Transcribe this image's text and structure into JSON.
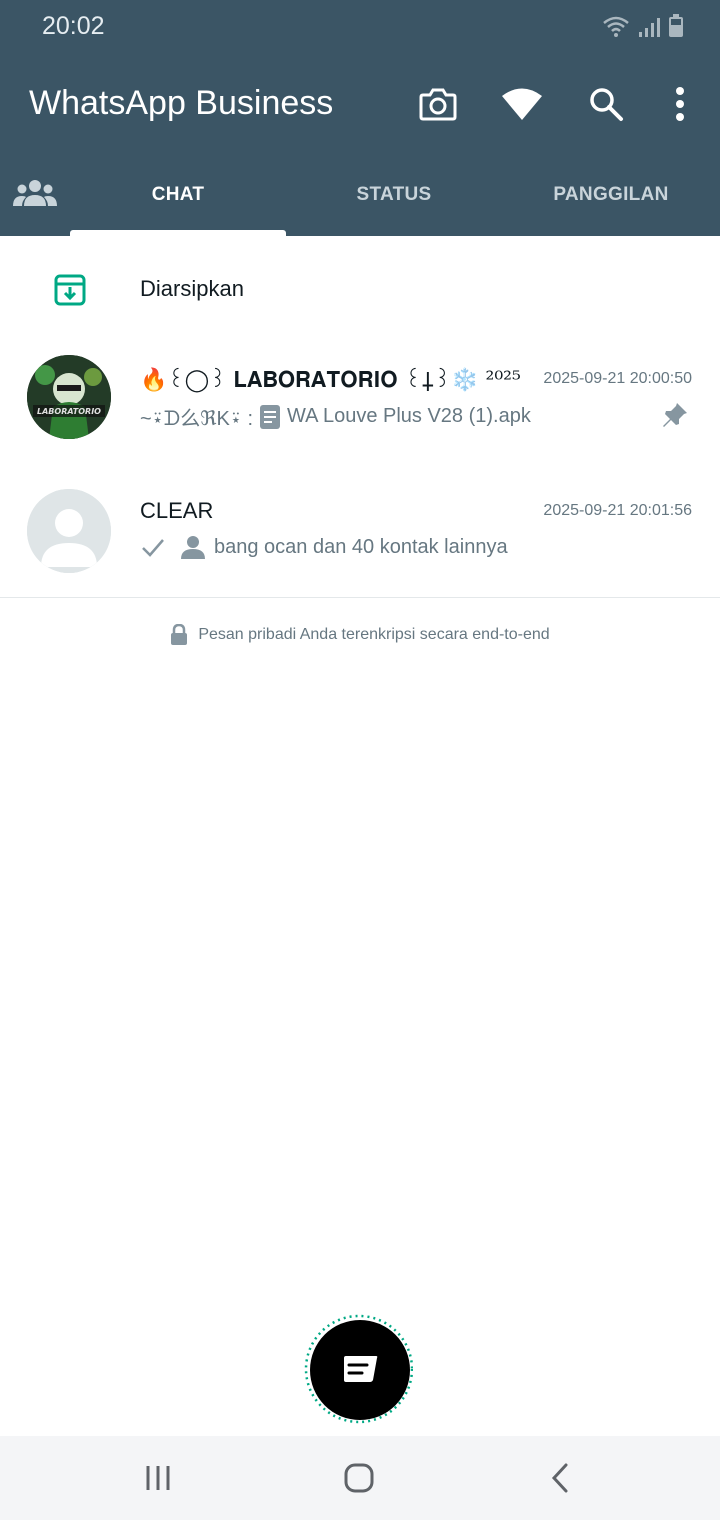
{
  "status_bar": {
    "time": "20:02",
    "icons": [
      "wifi-icon",
      "signal-icon",
      "battery-icon"
    ]
  },
  "app_bar": {
    "title": "WhatsApp Business",
    "actions": [
      "camera-icon",
      "wifi-status-icon",
      "search-icon",
      "more-options-icon"
    ]
  },
  "tabs": {
    "community_icon": "community-icon",
    "items": [
      {
        "label": "CHAT",
        "selected": true
      },
      {
        "label": "STATUS",
        "selected": false
      },
      {
        "label": "PANGGILAN",
        "selected": false
      }
    ]
  },
  "archived": {
    "label": "Diarsipkan",
    "icon": "archive-icon"
  },
  "chats": [
    {
      "name": "🔥꒰◯꒱ 𝐋𝐀𝐁𝐎𝐑𝐀𝐓𝐎𝐑𝐈𝐎 ꒰⸸꒱❄️ ²⁰²⁵",
      "time": "2025-09-21 20:00:50",
      "sender": "~⍣ᗪ么ℜK⍣ :",
      "preview": "WA Louve Plus V28 (1).apk",
      "pinned": true,
      "avatar_text": "LABORATORIO"
    },
    {
      "name": "CLEAR",
      "time": "2025-09-21 20:01:56",
      "preview": "bang ocan dan 40 kontak lainnya",
      "pinned": false
    }
  ],
  "footer_note": "Pesan pribadi Anda terenkripsi secara end-to-end",
  "fab": {
    "icon": "new-chat-icon"
  },
  "nav_bar": [
    "recents-icon",
    "home-icon",
    "back-icon"
  ],
  "colors": {
    "app_bar": "#3b5565",
    "accent": "#00a884",
    "fab": "#000000",
    "muted_text": "#667781"
  }
}
